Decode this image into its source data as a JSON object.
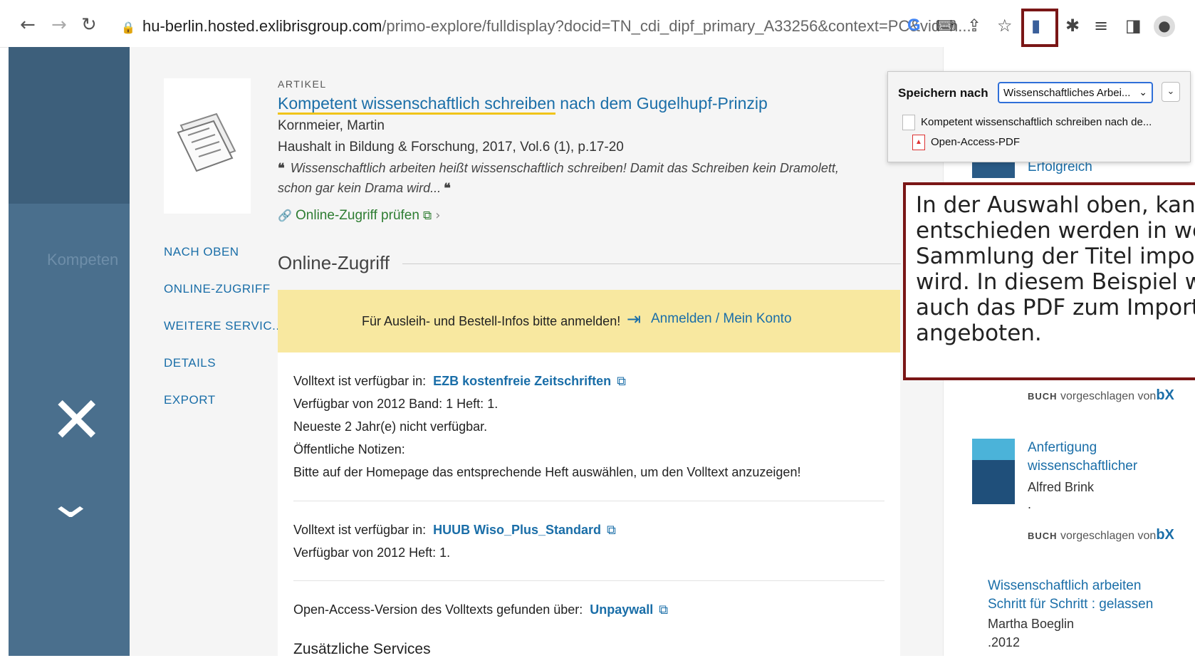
{
  "browser": {
    "url_host": "hu-berlin.hosted.exlibrisgroup.com",
    "url_path": "/primo-explore/fulldisplay?docid=TN_cdi_dipf_primary_A33256&context=PC&vid=h..."
  },
  "record": {
    "type": "ARTIKEL",
    "title_part1": "Kompetent wissenschaftlich schreiben",
    "title_part2": " nach dem Gugelhupf-Prinzip",
    "author": "Kornmeier, Martin",
    "source": "Haushalt in Bildung & Forschung, 2017, Vol.6 (1), p.17-20",
    "snippet_line1": "Wissenschaftlich arbeiten heißt wissenschaftlich schreiben! Damit das Schreiben kein Dramolett,",
    "snippet_line2": "schon gar kein Drama wird...",
    "check_access": "Online-Zugriff prüfen"
  },
  "side_nav": [
    "NACH OBEN",
    "ONLINE-ZUGRIFF",
    "WEITERE SERVIC...",
    "DETAILS",
    "EXPORT"
  ],
  "online_access": {
    "section_title": "Online-Zugriff",
    "login_text": "Für Ausleih- und Bestell-Infos bitte anmelden!",
    "login_link": "Anmelden / Mein Konto",
    "prefix": "Volltext ist verfügbar in:",
    "entry1_link": "EZB kostenfreie Zeitschriften",
    "entry1_l2": "Verfügbar von 2012 Band: 1 Heft: 1.",
    "entry1_l3": "Neueste 2 Jahr(e) nicht verfügbar.",
    "entry1_l4": "Öffentliche Notizen:",
    "entry1_l5": "Bitte auf der Homepage das entsprechende Heft auswählen, um den Volltext anzuzeigen!",
    "entry2_link": "HUUB Wiso_Plus_Standard",
    "entry2_l2": "Verfügbar von 2012 Heft: 1.",
    "oa_prefix": "Open-Access-Version des Volltexts gefunden über:",
    "oa_link": "Unpaywall",
    "more_services": "Zusätzliche Services"
  },
  "right_col": {
    "item0_title": "Erfolgreich",
    "suggest_prefix": "BUCH",
    "suggest_text": " vorgeschlagen von",
    "bx": "bX",
    "item1_title_l1": "Anfertigung",
    "item1_title_l2": "wissenschaftlicher",
    "item1_author": "Alfred Brink",
    "item1_dot": ".",
    "item2_title_l1": "Wissenschaftlich arbeiten",
    "item2_title_l2": "Schritt für Schritt : gelassen",
    "item2_author": "Martha Boeglin",
    "item2_year": ".2012"
  },
  "popup": {
    "label": "Speichern nach",
    "collection": "Wissenschaftliches Arbei...",
    "item1": "Kompetent wissenschaftlich schreiben nach de...",
    "item2": "Open-Access-PDF"
  },
  "annotation": {
    "text": "In der Auswahl oben, kann\nentschieden werden in wel\nSammlung der Titel impor\nwird. In diesem Beispiel w\nauch das PDF zum Import\nangeboten."
  },
  "left_overlay": {
    "partial_text": "Kompeten"
  }
}
